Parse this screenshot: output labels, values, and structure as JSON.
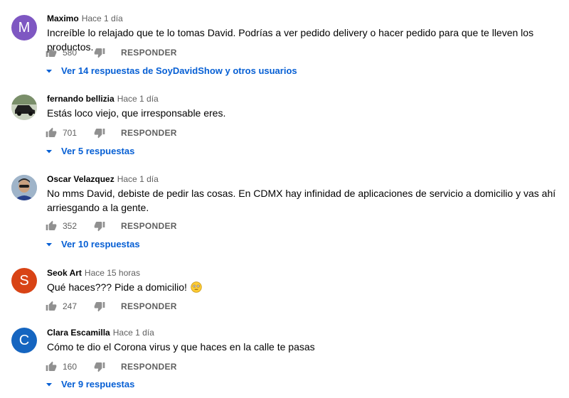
{
  "labels": {
    "reply": "RESPONDER"
  },
  "colors": {
    "link": "#065fd4",
    "muted": "#606060"
  },
  "comments": [
    {
      "author": "Maximo",
      "time": "Hace 1 día",
      "avatar_letter": "M",
      "avatar_color": "#7e57c2",
      "text": "Increíble lo relajado que te lo tomas David. Podrías a ver pedido delivery o hacer pedido para que te lleven los productos.",
      "likes": "580",
      "replies": "Ver 14 respuestas de SoyDavidShow y otros usuarios"
    },
    {
      "author": "fernando bellizia",
      "time": "Hace 1 día",
      "avatar_letter": "",
      "avatar_color": "#4a6b3a",
      "text": "Estás loco viejo, que irresponsable eres.",
      "likes": "701",
      "replies": "Ver 5 respuestas"
    },
    {
      "author": "Oscar Velazquez",
      "time": "Hace 1 día",
      "avatar_letter": "",
      "avatar_color": "#8aa0b8",
      "text": "No mms David, debiste de pedir las cosas. En CDMX hay infinidad de aplicaciones de servicio a domicilio y vas ahí arriesgando a la gente.",
      "likes": "352",
      "replies": "Ver 10 respuestas"
    },
    {
      "author": "Seok Art",
      "time": "Hace 15 horas",
      "avatar_letter": "S",
      "avatar_color": "#d84315",
      "text": "Qué haces??? Pide a domicilio!",
      "likes": "247",
      "replies": ""
    },
    {
      "author": "Clara Escamilla",
      "time": "Hace 1 día",
      "avatar_letter": "C",
      "avatar_color": "#1565c0",
      "text": "Cómo te dio el Corona virus y que haces en la calle te pasas",
      "likes": "160",
      "replies": "Ver 9 respuestas"
    }
  ]
}
